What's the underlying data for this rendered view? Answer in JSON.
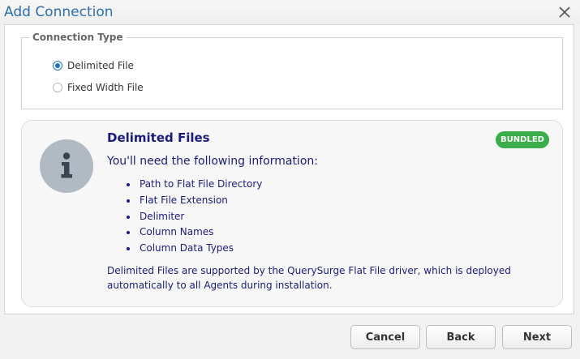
{
  "dialog": {
    "title": "Add Connection",
    "close_icon": "close-icon"
  },
  "connection_type": {
    "legend": "Connection Type",
    "options": [
      {
        "label": "Delimited File",
        "checked": true
      },
      {
        "label": "Fixed Width File",
        "checked": false
      }
    ]
  },
  "info": {
    "icon": "info-icon",
    "title": "Delimited Files",
    "badge": "BUNDLED",
    "heading": "You'll need the following information:",
    "requirements": [
      "Path to Flat File Directory",
      "Flat File Extension",
      "Delimiter",
      "Column Names",
      "Column Data Types"
    ],
    "note": "Delimited Files are supported by the QuerySurge Flat File driver, which is deployed automatically to all Agents during installation."
  },
  "buttons": {
    "cancel": "Cancel",
    "back": "Back",
    "next": "Next"
  },
  "colors": {
    "title": "#2a6fb0",
    "text_navy": "#1b1b7e",
    "badge": "#3aae4b",
    "radio_selected": "#1a73c8",
    "info_icon_bg": "#b1b9c3"
  }
}
